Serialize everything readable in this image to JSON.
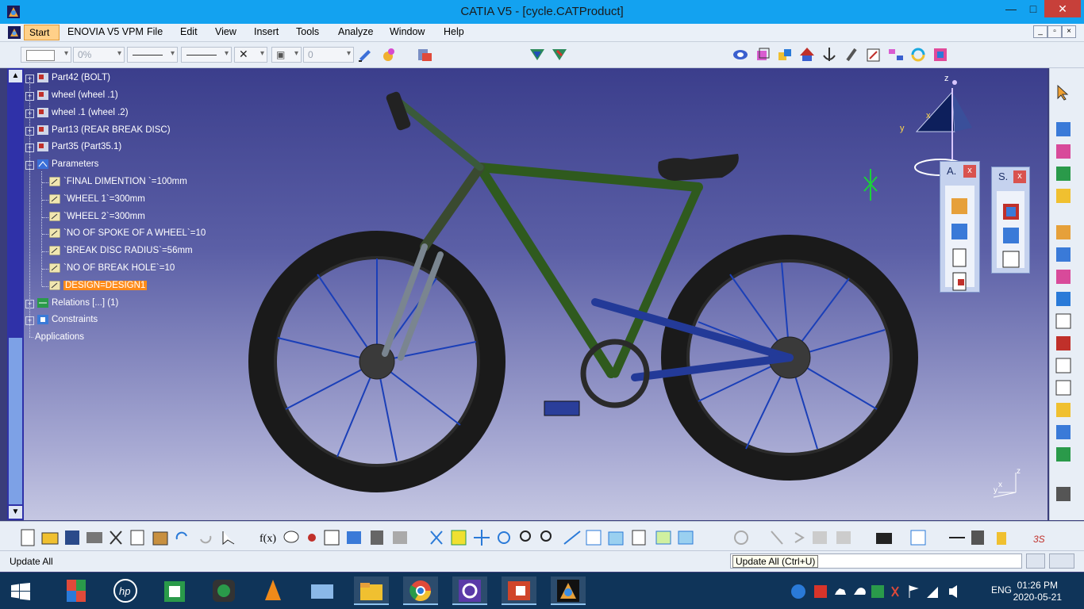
{
  "window": {
    "title": "CATIA V5 - [cycle.CATProduct]",
    "min": "—",
    "max": "□",
    "close": "✕"
  },
  "menu": {
    "items": [
      "Start",
      "ENOVIA V5 VPM",
      "File",
      "Edit",
      "View",
      "Insert",
      "Tools",
      "Analyze",
      "Window",
      "Help"
    ],
    "mdi": [
      "_",
      "▫",
      "×"
    ]
  },
  "toolbar": {
    "transparency": "0%",
    "layer_value": "0"
  },
  "tree": {
    "nodes": [
      {
        "label": "Part42 (BOLT)"
      },
      {
        "label": "wheel  (wheel .1)"
      },
      {
        "label": "wheel .1 (wheel .2)"
      },
      {
        "label": "Part13 (REAR BREAK DISC)"
      },
      {
        "label": "Part35 (Part35.1)"
      },
      {
        "label": "Parameters"
      },
      {
        "label": "`FINAL DIMENTION `=100mm"
      },
      {
        "label": "`WHEEL 1`=300mm"
      },
      {
        "label": "`WHEEL 2`=300mm"
      },
      {
        "label": "`NO OF SPOKE OF A WHEEL`=10"
      },
      {
        "label": "`BREAK DISC RADIUS`=56mm"
      },
      {
        "label": "`NO OF BREAK HOLE`=10"
      },
      {
        "label": "DESIGN=DESIGN1"
      },
      {
        "label": "Relations [...] (1)"
      },
      {
        "label": "Constraints"
      },
      {
        "label": "Applications"
      }
    ]
  },
  "compass": {
    "x": "x",
    "y": "y",
    "z": "z"
  },
  "axis_mini": {
    "x": "x",
    "y": "y",
    "z": "z"
  },
  "floating": [
    {
      "title": "A.",
      "close": "x"
    },
    {
      "title": "S.",
      "close": "x"
    }
  ],
  "status": {
    "message": "Update All",
    "tooltip": "Update All (Ctrl+U)"
  },
  "taskbar": {
    "time": "01:26 PM",
    "date": "2020-05-21",
    "lang": "ENG"
  }
}
